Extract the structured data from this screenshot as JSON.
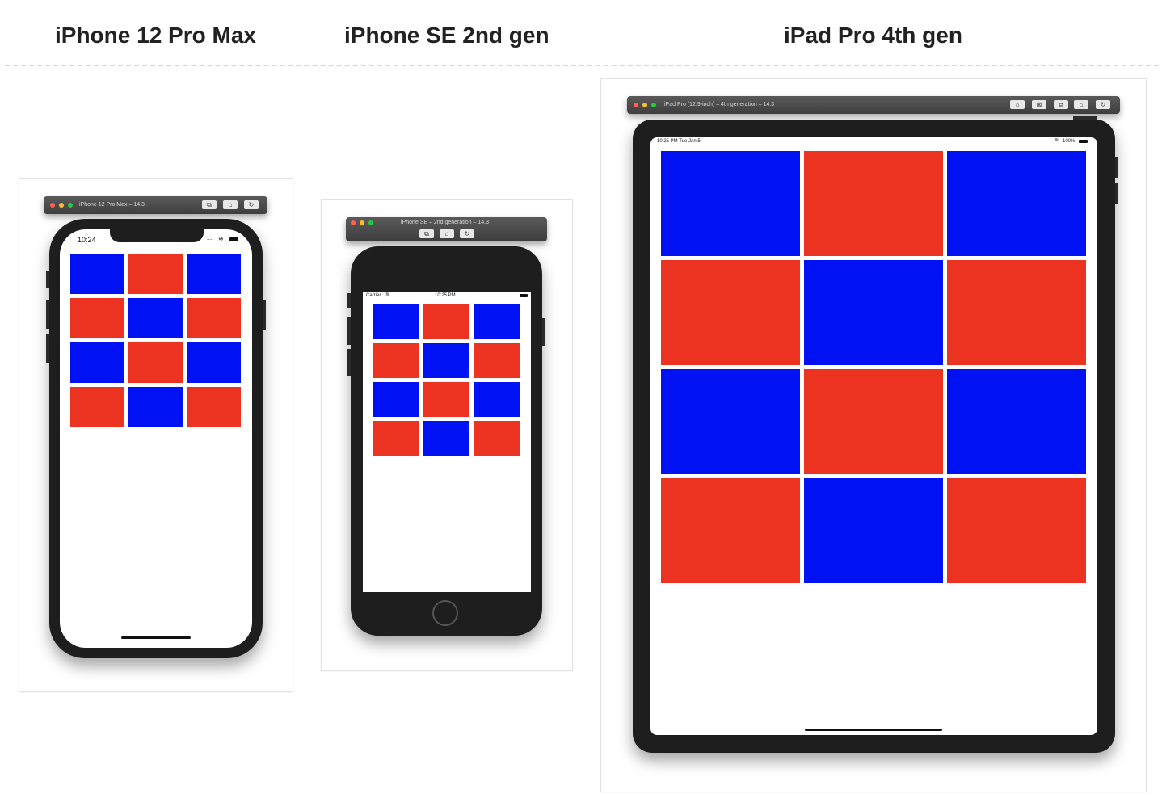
{
  "headings": {
    "iphone12": "iPhone 12 Pro Max",
    "iphonese": "iPhone SE 2nd gen",
    "ipad": "iPad Pro 4th gen"
  },
  "colors": {
    "blue": "#0012f4",
    "red": "#ec3322",
    "traffic_red": "#fe5f57",
    "traffic_yellow": "#febc2e",
    "traffic_green": "#28c840"
  },
  "grid_pattern": [
    [
      "blue",
      "red",
      "blue"
    ],
    [
      "red",
      "blue",
      "red"
    ],
    [
      "blue",
      "red",
      "blue"
    ],
    [
      "red",
      "blue",
      "red"
    ]
  ],
  "simulators": {
    "iphone12": {
      "title": "iPhone 12 Pro Max – 14.3",
      "status_time": "10:24",
      "status_dots": "....",
      "toolbar_icons": [
        "screenshot-icon",
        "home-icon",
        "rotate-icon"
      ]
    },
    "iphonese": {
      "title": "iPhone SE – 2nd generation – 14.3",
      "status_carrier": "Carrier",
      "status_time": "10:25 PM",
      "toolbar_icons": [
        "screenshot-icon",
        "home-icon",
        "rotate-icon"
      ]
    },
    "ipad": {
      "title": "iPad Pro (12.9-inch) – 4th generation – 14.3",
      "status_time": "10:25 PM   Tue Jan 5",
      "status_battery": "100%",
      "toolbar_icons": [
        "brightness-icon",
        "close-screen-icon",
        "screenshot-icon",
        "home-icon",
        "rotate-icon"
      ]
    }
  }
}
